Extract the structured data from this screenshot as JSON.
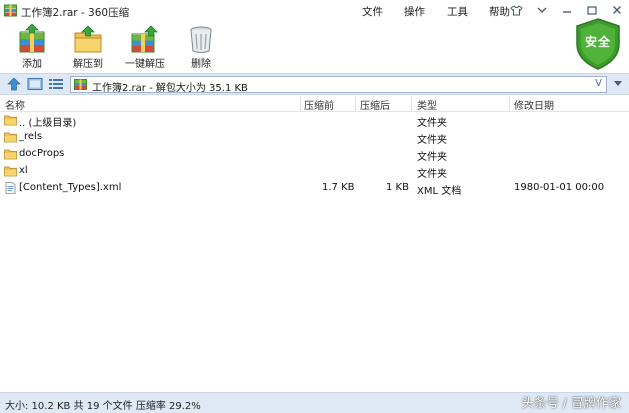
{
  "window": {
    "title": "工作簿2.rar - 360压缩"
  },
  "menu": {
    "items": [
      "文件",
      "操作",
      "工具",
      "帮助"
    ]
  },
  "toolbar": {
    "add_label": "添加",
    "extract_to_label": "解压到",
    "one_click_extract_label": "一键解压",
    "delete_label": "删除"
  },
  "shield": {
    "label": "安全",
    "color": "#3f9a2e"
  },
  "address": {
    "path": "工作簿2.rar - 解包大小为 35.1 KB",
    "v_glyph": "V"
  },
  "list": {
    "headers": {
      "name": "名称",
      "compressed": "压缩前",
      "uncompressed": "压缩后",
      "type": "类型",
      "modified": "修改日期"
    },
    "rows": [
      {
        "name": ".. (上级目录)",
        "icon": "folder-icon",
        "size_before": "",
        "size_after": "",
        "type": "文件夹",
        "modified": ""
      },
      {
        "name": "_rels",
        "icon": "folder-icon",
        "size_before": "",
        "size_after": "",
        "type": "文件夹",
        "modified": ""
      },
      {
        "name": "docProps",
        "icon": "folder-icon",
        "size_before": "",
        "size_after": "",
        "type": "文件夹",
        "modified": ""
      },
      {
        "name": "xl",
        "icon": "folder-icon",
        "size_before": "",
        "size_after": "",
        "type": "文件夹",
        "modified": ""
      },
      {
        "name": "[Content_Types].xml",
        "icon": "xml-file-icon",
        "size_before": "1.7 KB",
        "size_after": "1 KB",
        "type": "XML 文档",
        "modified": "1980-01-01 00:00"
      }
    ]
  },
  "status": {
    "text": "大小: 10.2 KB 共 19 个文件 压缩率 29.2%"
  },
  "watermark": {
    "text": "头条号 / 冒牌作家"
  },
  "colors": {
    "bar_bg": "#dfe9f5",
    "folder_yellow": "#f2c14e"
  }
}
